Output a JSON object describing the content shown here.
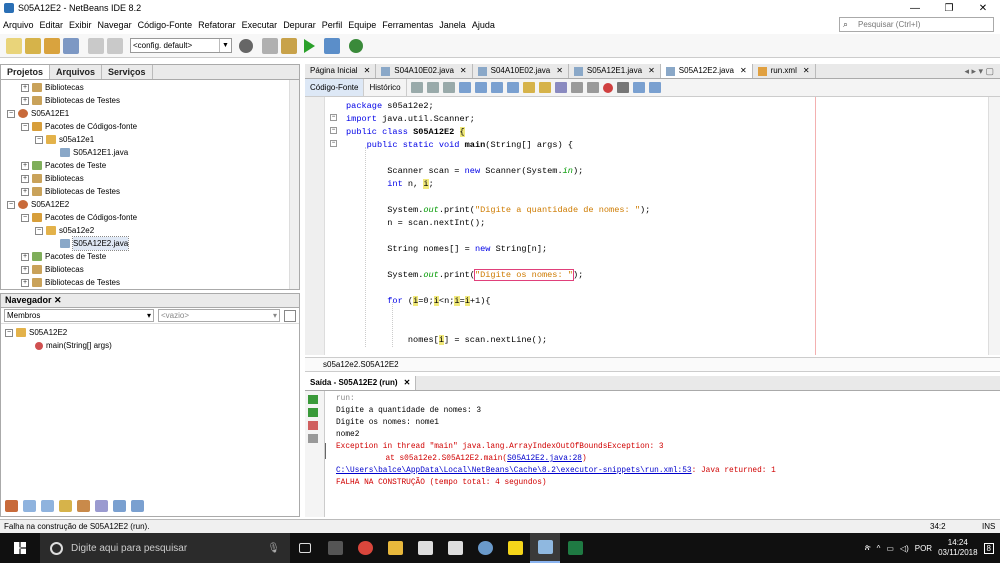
{
  "window": {
    "title": "S05A12E2 - NetBeans IDE 8.2",
    "minimize": "—",
    "maximize": "❐",
    "close": "✕"
  },
  "menu": [
    "Arquivo",
    "Editar",
    "Exibir",
    "Navegar",
    "Código-Fonte",
    "Refatorar",
    "Executar",
    "Depurar",
    "Perfil",
    "Equipe",
    "Ferramentas",
    "Janela",
    "Ajuda"
  ],
  "search": {
    "placeholder": "Pesquisar (Ctrl+I)"
  },
  "toolbar": {
    "config_combo": "<config. default>"
  },
  "projects_panel": {
    "tabs": [
      "Projetos",
      "Arquivos",
      "Serviços"
    ],
    "tree": [
      {
        "label": "Bibliotecas",
        "level": 1,
        "icon": "library-icon"
      },
      {
        "label": "Bibliotecas de Testes",
        "level": 1,
        "icon": "library-icon"
      },
      {
        "label": "S05A12E1",
        "level": 0,
        "icon": "project-icon"
      },
      {
        "label": "Pacotes de Códigos-fonte",
        "level": 1,
        "icon": "source-package-icon"
      },
      {
        "label": "s05a12e1",
        "level": 2,
        "icon": "package-icon"
      },
      {
        "label": "S05A12E1.java",
        "level": 3,
        "icon": "java-file-icon"
      },
      {
        "label": "Pacotes de Teste",
        "level": 1,
        "icon": "test-package-icon"
      },
      {
        "label": "Bibliotecas",
        "level": 1,
        "icon": "library-icon"
      },
      {
        "label": "Bibliotecas de Testes",
        "level": 1,
        "icon": "library-icon"
      },
      {
        "label": "S05A12E2",
        "level": 0,
        "icon": "project-icon"
      },
      {
        "label": "Pacotes de Códigos-fonte",
        "level": 1,
        "icon": "source-package-icon"
      },
      {
        "label": "s05a12e2",
        "level": 2,
        "icon": "package-icon"
      },
      {
        "label": "S05A12E2.java",
        "level": 3,
        "icon": "java-file-icon"
      },
      {
        "label": "Pacotes de Teste",
        "level": 1,
        "icon": "test-package-icon"
      },
      {
        "label": "Bibliotecas",
        "level": 1,
        "icon": "library-icon"
      },
      {
        "label": "Bibliotecas de Testes",
        "level": 1,
        "icon": "library-icon"
      }
    ]
  },
  "navigator": {
    "title": "Navegador",
    "members_label": "Membros",
    "filter": "<vazio>",
    "class_node": "S05A12E2",
    "method_node": "main(String[] args)"
  },
  "editor": {
    "tabs": [
      "Página Inicial",
      "S04A10E02.java",
      "S04A10E02.java",
      "S05A12E1.java",
      "S05A12E2.java",
      "run.xml"
    ],
    "active_tab": "S05A12E2.java",
    "source_button": "Código-Fonte",
    "history_button": "Histórico",
    "line_numbers": [
      "1",
      "2",
      "3",
      "4",
      "5",
      "6",
      "7",
      "8",
      "9",
      "10",
      "11",
      "12",
      "13",
      "14",
      "15",
      "16",
      "17",
      "18",
      "19"
    ],
    "breadcrumb": "s05a12e2.S05A12E2"
  },
  "output": {
    "tab": "Saída - S05A12E2 (run)",
    "lines": [
      "run:",
      "Digite a quantidade de nomes: 3",
      "Digite os nomes: nome1",
      "nome2",
      "Exception in thread \"main\" java.lang.ArrayIndexOutOfBoundsException: 3",
      "\tat s05a12e2.S05A12E2.main(",
      "S05A12E2.java:28",
      ")",
      "C:\\Users\\balce\\AppData\\Local\\NetBeans\\Cache\\8.2\\executor-snippets\\run.xml:53",
      ": Java returned: 1",
      "FALHA NA CONSTRUÇÃO (tempo total: 4 segundos)"
    ]
  },
  "status": {
    "message": "Falha na construção de S05A12E2 (run).",
    "position": "34:2",
    "mode": "INS"
  },
  "taskbar": {
    "search_placeholder": "Digite aqui para pesquisar",
    "language": "POR",
    "time": "14:24",
    "date": "03/11/2018",
    "notifications": "8"
  }
}
